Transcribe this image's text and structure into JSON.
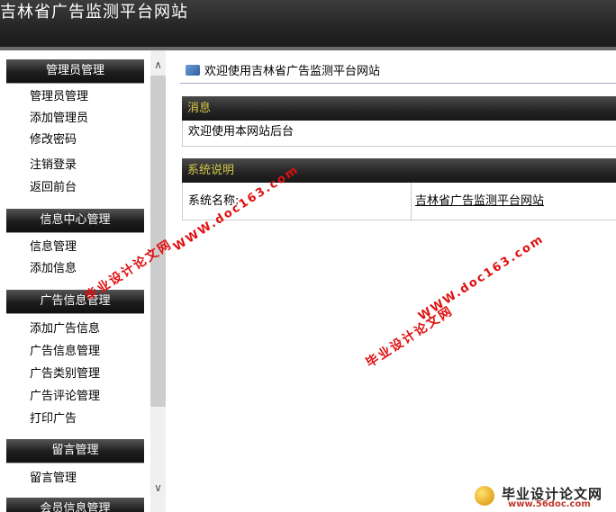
{
  "header": {
    "title": "吉林省广告监测平台网站"
  },
  "sidebar": {
    "sections": [
      {
        "title": "管理员管理",
        "items": [
          "管理员管理",
          "添加管理员",
          "修改密码",
          "注销登录",
          "返回前台"
        ]
      },
      {
        "title": "信息中心管理",
        "items": [
          "信息管理",
          "添加信息"
        ]
      },
      {
        "title": "广告信息管理",
        "items": [
          "添加广告信息",
          "广告信息管理",
          "广告类别管理",
          "广告评论管理",
          "打印广告"
        ]
      },
      {
        "title": "留言管理",
        "items": [
          "留言管理"
        ]
      },
      {
        "title": "会员信息管理",
        "items": []
      }
    ]
  },
  "main": {
    "welcome": "欢迎使用吉林省广告监测平台网站",
    "news": {
      "title": "消息",
      "body": "欢迎使用本网站后台"
    },
    "system": {
      "title": "系统说明",
      "label": "系统名称:",
      "value": "吉林省广告监测平台网站"
    }
  },
  "watermark": {
    "site": "WWW.doc163.com",
    "cn": "毕业设计论文网"
  },
  "logo": {
    "cn": "毕业设计论文网",
    "url": "www.56doc.com"
  }
}
